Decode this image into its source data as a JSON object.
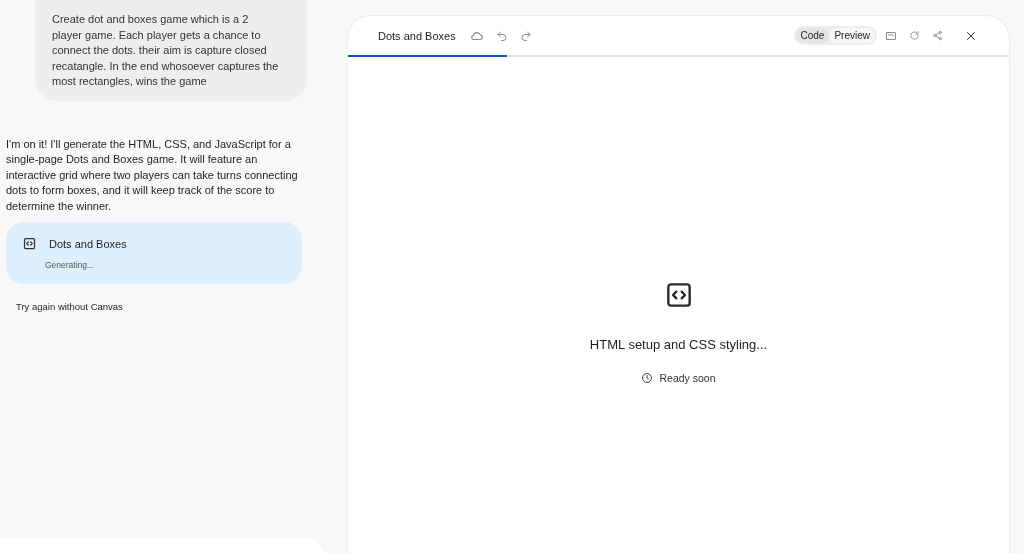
{
  "conversation": {
    "user_message": "Create dot and boxes game which is a 2 player game. Each player gets a chance to connect the dots. their aim is capture closed recatangle. In the end whosoever captures the most rectangles, wins the game",
    "response": "I'm on it! I'll generate the HTML, CSS, and JavaScript for a single-page Dots and Boxes game. It will feature an interactive grid where two players can take turns connecting dots to form boxes, and it will keep track of the score to determine the winner.",
    "artifact_card": {
      "title": "Dots and Boxes",
      "status": "Generating..."
    },
    "retry_link": "Try again without Canvas"
  },
  "canvas": {
    "title": "Dots and Boxes",
    "view_toggle": [
      {
        "label": "Code",
        "selected": true
      },
      {
        "label": "Preview",
        "selected": false
      }
    ],
    "progress": {
      "level": 0.24
    },
    "status": {
      "message": "HTML setup and CSS styling...",
      "eta": "Ready soon"
    }
  }
}
